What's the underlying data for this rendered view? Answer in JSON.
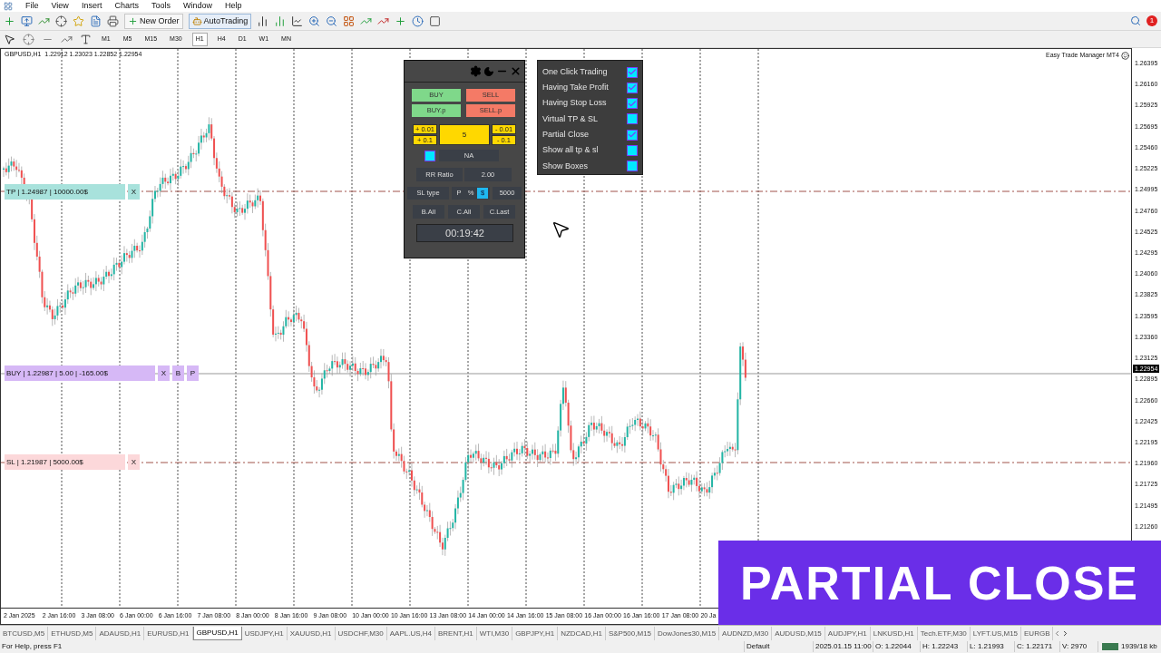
{
  "menu": [
    "File",
    "View",
    "Insert",
    "Charts",
    "Tools",
    "Window",
    "Help"
  ],
  "toolbar": {
    "new_order": "New Order",
    "autotrading": "AutoTrading",
    "notification_count": "1"
  },
  "timeframes": [
    {
      "label": "M1",
      "selected": false
    },
    {
      "label": "M5",
      "selected": false
    },
    {
      "label": "M15",
      "selected": false
    },
    {
      "label": "M30",
      "selected": false
    },
    {
      "label": "H1",
      "selected": true
    },
    {
      "label": "H4",
      "selected": false
    },
    {
      "label": "D1",
      "selected": false
    },
    {
      "label": "W1",
      "selected": false
    },
    {
      "label": "MN",
      "selected": false
    }
  ],
  "chart": {
    "header": "GBPUSD,H1  1.22912 1.23023 1.22852 1.22954",
    "indicator_name": "Easy Trade Manager MT4",
    "price_labels": [
      "1.26395",
      "1.26160",
      "1.25925",
      "1.25695",
      "1.25460",
      "1.25225",
      "1.24995",
      "1.24760",
      "1.24525",
      "1.24295",
      "1.24060",
      "1.23825",
      "1.23595",
      "1.23360",
      "1.23125",
      "1.22895",
      "1.22660",
      "1.22425",
      "1.22195",
      "1.21960",
      "1.21725",
      "1.21495",
      "1.21260"
    ],
    "current_price": "1.22954",
    "time_labels": [
      "2 Jan 2025",
      "2 Jan 16:00",
      "3 Jan 08:00",
      "6 Jan 00:00",
      "6 Jan 16:00",
      "7 Jan 08:00",
      "8 Jan 00:00",
      "8 Jan 16:00",
      "9 Jan 08:00",
      "10 Jan 00:00",
      "10 Jan 16:00",
      "13 Jan 08:00",
      "14 Jan 00:00",
      "14 Jan 16:00",
      "15 Jan 08:00",
      "16 Jan 00:00",
      "16 Jan 16:00",
      "17 Jan 08:00",
      "20 Ja"
    ],
    "tp_label": {
      "text": "TP | 1.24987 | 10000.00$",
      "buttons": [
        "X"
      ]
    },
    "buy_label": {
      "text": "BUY | 1.22987 | 5.00 | -165.00$",
      "buttons": [
        "X",
        "B",
        "P"
      ]
    },
    "sl_label": {
      "text": "SL | 1.21987 | 5000.00$",
      "buttons": [
        "X"
      ]
    }
  },
  "trade_panel": {
    "buy": "BUY",
    "sell": "SELL",
    "buy_p": "BUY.p",
    "sell_p": "SELL.p",
    "lot_plus": [
      "+ 0.01",
      "+ 0.1"
    ],
    "lot": "5",
    "lot_minus": [
      "- 0.01",
      "- 0.1"
    ],
    "toggle_checked": false,
    "na": "NA",
    "rr_label": "RR Ratio",
    "rr_value": "2.00",
    "sl_type_label": "SL type",
    "sl_modes": [
      {
        "label": "P",
        "selected": false
      },
      {
        "label": "%",
        "selected": false
      },
      {
        "label": "$",
        "selected": true
      }
    ],
    "sl_value": "5000",
    "actions": [
      "B.All",
      "C.All",
      "C.Last"
    ],
    "timer": "00:19:42"
  },
  "options": [
    {
      "label": "One Click Trading",
      "checked": true
    },
    {
      "label": "Having Take Profit",
      "checked": true
    },
    {
      "label": "Having Stop Loss",
      "checked": true
    },
    {
      "label": "Virtual TP & SL",
      "checked": false
    },
    {
      "label": "Partial Close",
      "checked": true
    },
    {
      "label": "Show all tp & sl",
      "checked": false
    },
    {
      "label": "Show Boxes",
      "checked": false
    }
  ],
  "banner": "PARTIAL CLOSE",
  "tabs": [
    {
      "label": "BTCUSD,M5",
      "selected": false
    },
    {
      "label": "ETHUSD,M5",
      "selected": false
    },
    {
      "label": "ADAUSD,H1",
      "selected": false
    },
    {
      "label": "EURUSD,H1",
      "selected": false
    },
    {
      "label": "GBPUSD,H1",
      "selected": true
    },
    {
      "label": "USDJPY,H1",
      "selected": false
    },
    {
      "label": "XAUUSD,H1",
      "selected": false
    },
    {
      "label": "USDCHF,M30",
      "selected": false
    },
    {
      "label": "AAPL.US,H4",
      "selected": false
    },
    {
      "label": "BRENT,H1",
      "selected": false
    },
    {
      "label": "WTI,M30",
      "selected": false
    },
    {
      "label": "GBPJPY,H1",
      "selected": false
    },
    {
      "label": "NZDCAD,H1",
      "selected": false
    },
    {
      "label": "S&P500,M15",
      "selected": false
    },
    {
      "label": "DowJones30,M15",
      "selected": false
    },
    {
      "label": "AUDNZD,M30",
      "selected": false
    },
    {
      "label": "AUDUSD,M15",
      "selected": false
    },
    {
      "label": "AUDJPY,H1",
      "selected": false
    },
    {
      "label": "LNKUSD,H1",
      "selected": false
    },
    {
      "label": "Tech.ETF,M30",
      "selected": false
    },
    {
      "label": "LYFT.US,M15",
      "selected": false
    },
    {
      "label": "EURGB",
      "selected": false
    }
  ],
  "status_bar": {
    "help": "For Help, press F1",
    "profile": "Default",
    "datetime": "2025.01.15 11:00",
    "open": "O: 1.22044",
    "high": "H: 1.22243",
    "low": "L: 1.21993",
    "close": "C: 1.22171",
    "volume": "V: 2970",
    "traffic": "1939/18 kb"
  }
}
